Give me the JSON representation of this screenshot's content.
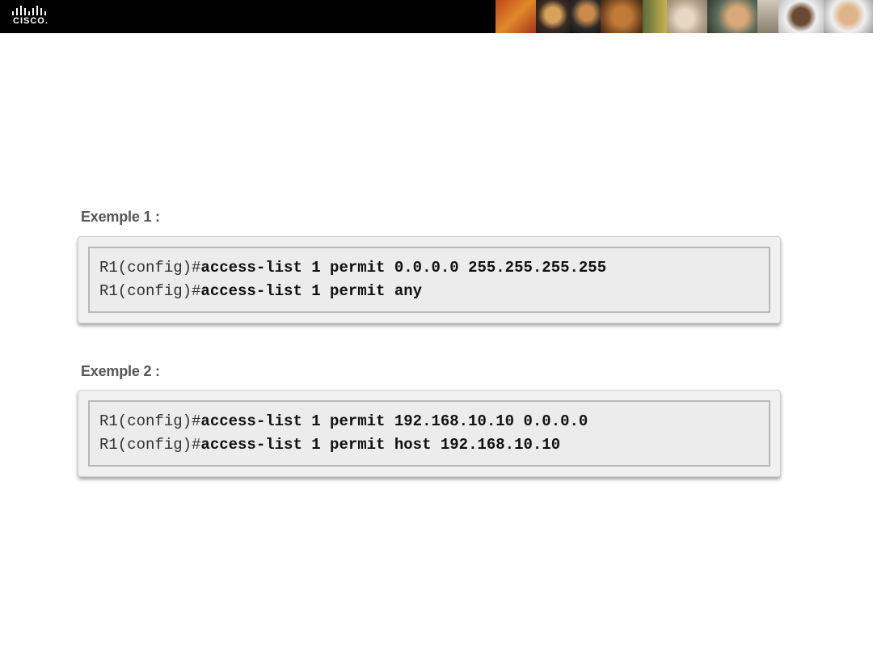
{
  "header": {
    "logo_text": "CISCO.",
    "photo_strip_colors": [
      "#c0451a",
      "#d7a35a",
      "#3a2a22",
      "#1c1c1c",
      "#c98a4a",
      "#7a4a1f",
      "#e6d7c0",
      "#5a6b3c",
      "#d1c8b8",
      "#2b2b2b",
      "#8a7a6a",
      "#efefef"
    ]
  },
  "examples": [
    {
      "label": "Exemple 1 :",
      "lines": [
        {
          "prompt": "R1(config)#",
          "command": "access-list 1 permit 0.0.0.0 255.255.255.255"
        },
        {
          "prompt": "R1(config)#",
          "command": "access-list 1 permit any"
        }
      ]
    },
    {
      "label": "Exemple 2 :",
      "lines": [
        {
          "prompt": "R1(config)#",
          "command": "access-list 1 permit 192.168.10.10 0.0.0.0"
        },
        {
          "prompt": "R1(config)#",
          "command": "access-list 1 permit host 192.168.10.10"
        }
      ]
    }
  ]
}
